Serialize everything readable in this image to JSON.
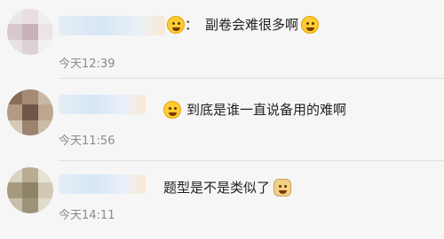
{
  "comments": [
    {
      "message": "副卷会难很多啊",
      "separator": "：",
      "time": "今天12:39",
      "leading_icon": "smiling-face-emoji",
      "trailing_icon": "laughing-tears-emoji",
      "avatar_colors": [
        "#ece7ea",
        "#e9dfe3",
        "#f1eef0",
        "#d8c7cd",
        "#c8b1ba",
        "#ede4e7",
        "#e8e1e4",
        "#dcd1d6",
        "#f3f0f2"
      ]
    },
    {
      "message": "到底是谁一直说备用的难啊",
      "time": "今天11:56",
      "leading_icon": "worried-face-emoji",
      "avatar_colors": [
        "#8a6e5a",
        "#a38b76",
        "#c9b8a6",
        "#b39a84",
        "#6f5747",
        "#bda58e",
        "#d7c8b8",
        "#9c8370",
        "#cdbba8"
      ]
    },
    {
      "message": "题型是不是类似了",
      "time": "今天14:11",
      "trailing_icon": "doge-emoji",
      "avatar_colors": [
        "#d9d3c3",
        "#b8ac92",
        "#e7e2d6",
        "#a69a7e",
        "#8f8468",
        "#d2c9b5",
        "#c6bfad",
        "#9d937a",
        "#e1dbcc"
      ]
    }
  ]
}
